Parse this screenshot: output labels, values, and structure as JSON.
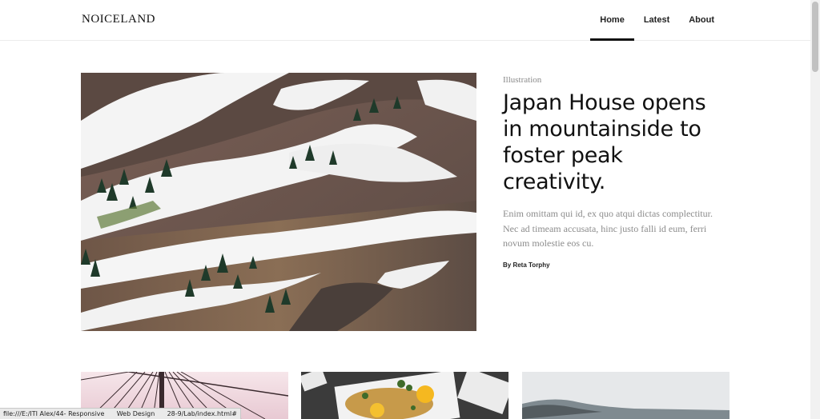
{
  "header": {
    "logo": "NOICELAND",
    "nav": [
      {
        "label": "Home",
        "active": true
      },
      {
        "label": "Latest",
        "active": false
      },
      {
        "label": "About",
        "active": false
      }
    ]
  },
  "featured": {
    "category": "Illustration",
    "title": "Japan House opens in mountainside to foster peak creativity.",
    "excerpt": "Enim omittam qui id, ex quo atqui dictas complectitur. Nec ad timeam accusata, hinc justo falli id eum, ferri novum molestie eos cu.",
    "byline": "By Reta Torphy"
  },
  "status_url": "file:///E:/ITI Alex/44- Responsive      Web Design      28-9/Lab/index.html#",
  "colors": {
    "accent": "#111111",
    "muted_text": "#8c8c8c"
  }
}
